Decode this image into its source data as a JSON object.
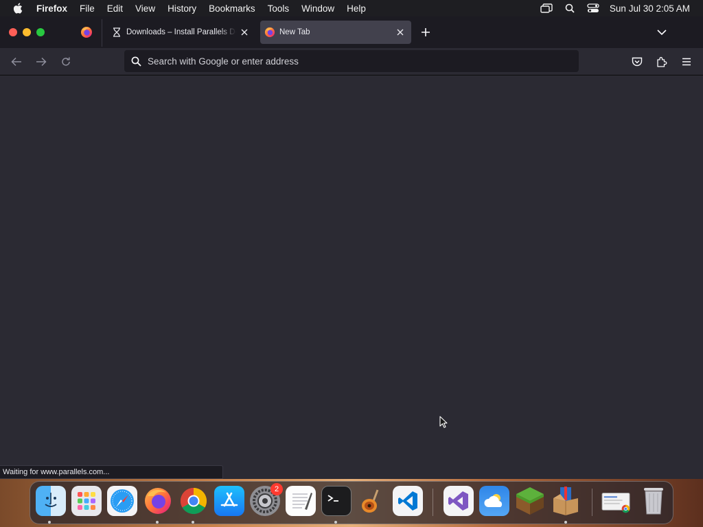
{
  "menubar": {
    "app_name": "Firefox",
    "items": [
      "File",
      "Edit",
      "View",
      "History",
      "Bookmarks",
      "Tools",
      "Window",
      "Help"
    ],
    "clock": "Sun Jul 30  2:05 AM"
  },
  "tabs": [
    {
      "title": "Downloads – Install Parallels Desktop",
      "icon": "hourglass-icon",
      "active": false
    },
    {
      "title": "New Tab",
      "icon": "firefox-icon",
      "active": true
    }
  ],
  "urlbar": {
    "placeholder": "Search with Google or enter address",
    "value": ""
  },
  "status": {
    "text": "Waiting for www.parallels.com..."
  },
  "dock": {
    "apps": [
      "finder",
      "launchpad",
      "safari",
      "firefox",
      "chrome",
      "app-store",
      "system-settings",
      "textedit",
      "terminal",
      "garageband",
      "vscode",
      "visual-studio",
      "weather",
      "minecraft",
      "installer",
      "chrome-apps-folder",
      "trash"
    ],
    "system_settings_badge": "2"
  },
  "colors": {
    "window_bg": "#2b2a33",
    "tabbar_bg": "#1c1b22",
    "active_tab": "#42414d"
  }
}
